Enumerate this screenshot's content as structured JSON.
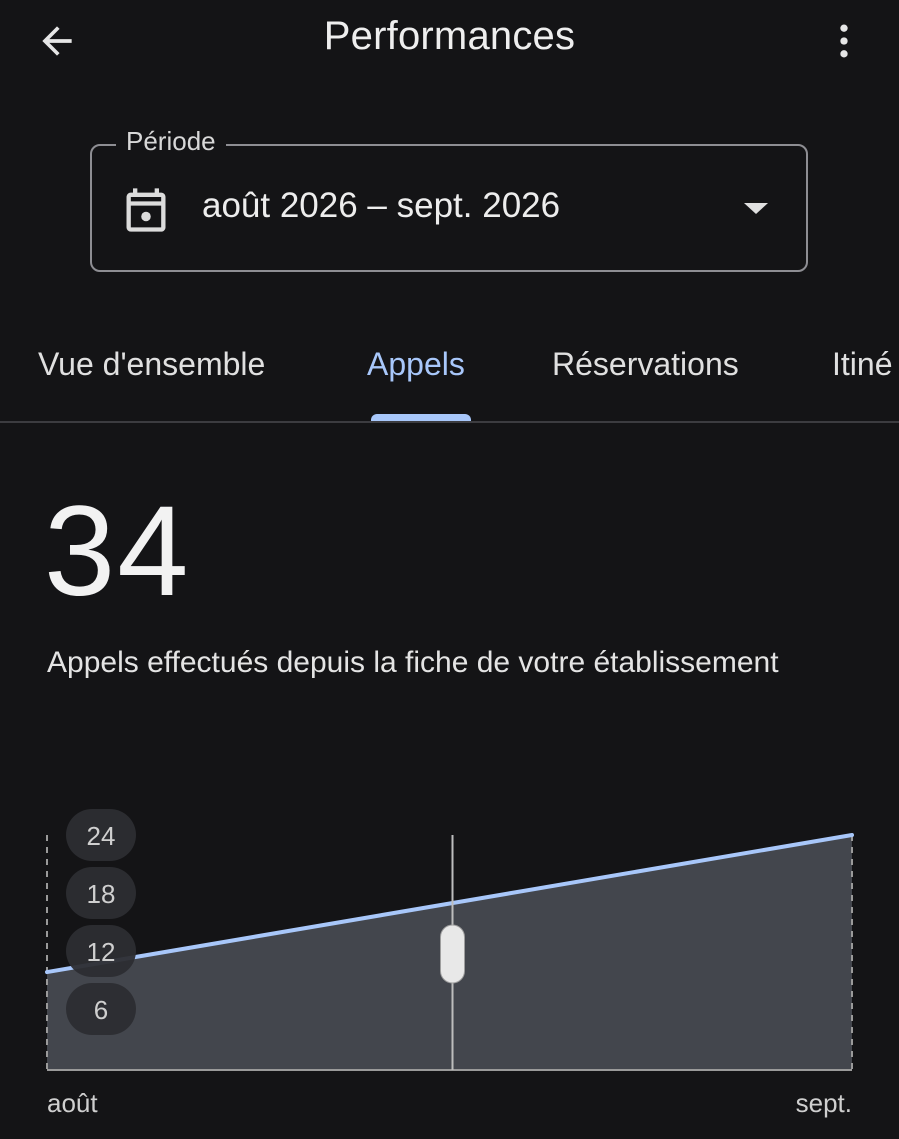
{
  "app_bar": {
    "title": "Performances",
    "back_icon": "arrow-back-icon",
    "more_icon": "more-vert-icon"
  },
  "period": {
    "label": "Période",
    "value": "août 2026 – sept. 2026",
    "icon": "calendar-icon",
    "dropdown_icon": "arrow-drop-down-icon"
  },
  "tabs": [
    {
      "label": "Vue d'ensemble",
      "active": false
    },
    {
      "label": "Appels",
      "active": true
    },
    {
      "label": "Réservations",
      "active": false
    },
    {
      "label": "Itiné",
      "active": false
    }
  ],
  "metric": {
    "value": "34",
    "description": "Appels effectués depuis la fiche de votre établissement"
  },
  "colors": {
    "background": "#141416",
    "accent": "#a8c7fa",
    "area_fill": "#43464d",
    "text": "#e3e3e3"
  },
  "chart_data": {
    "type": "area",
    "x": [
      "août",
      "sept."
    ],
    "y_ticks": [
      6,
      12,
      18,
      24
    ],
    "ylim": [
      0,
      24
    ],
    "series": [
      {
        "values": [
          10,
          24
        ]
      }
    ],
    "cursor_fraction": 0.5,
    "grid": false
  }
}
